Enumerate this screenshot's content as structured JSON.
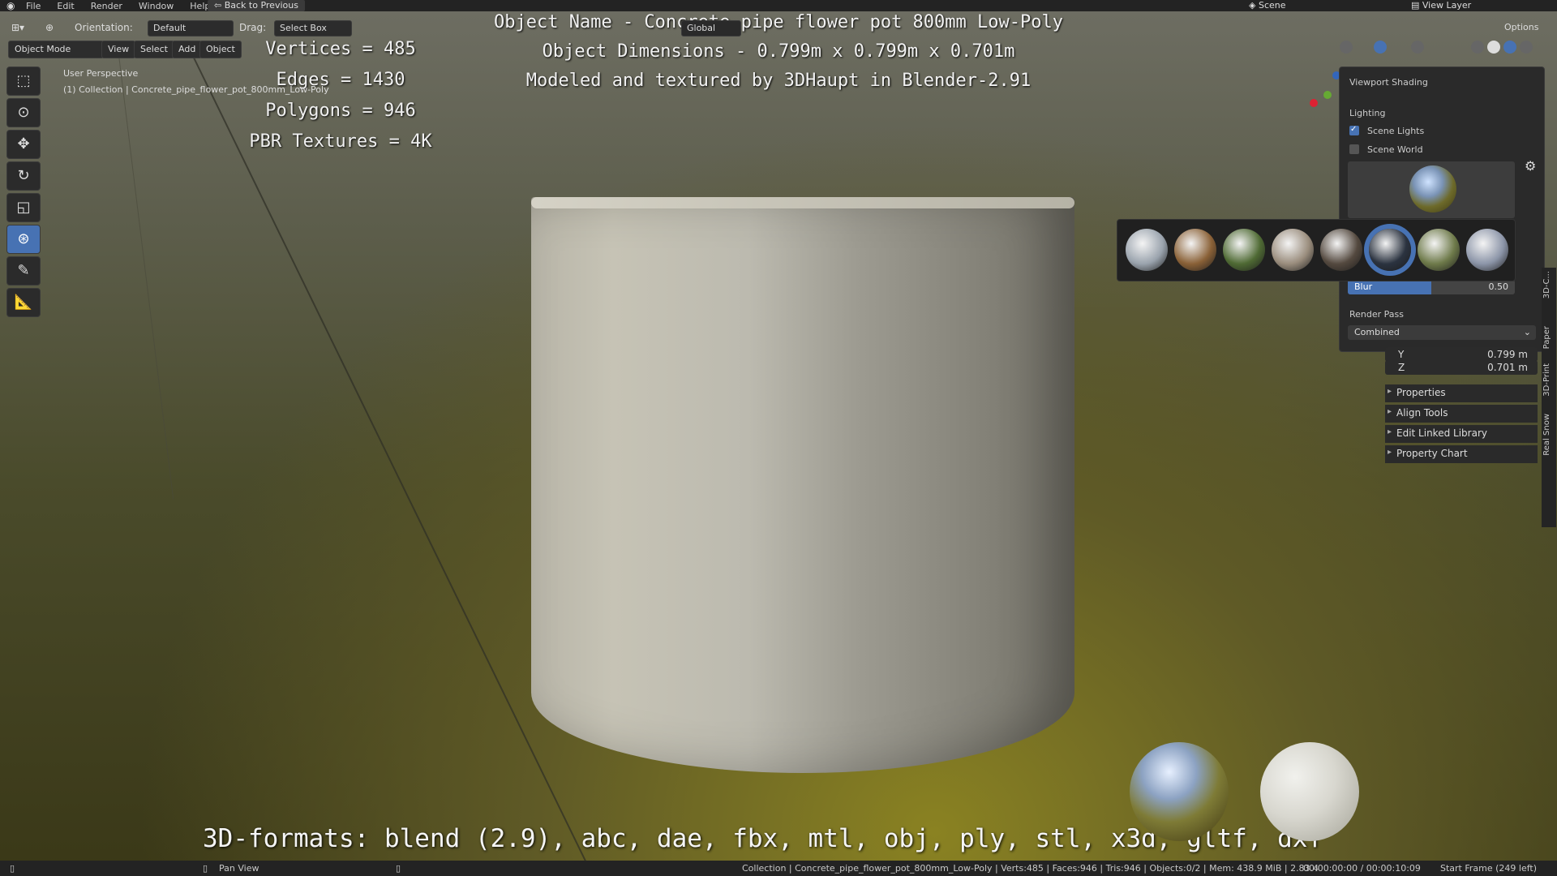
{
  "menu": [
    "File",
    "Edit",
    "Render",
    "Window",
    "Help"
  ],
  "back_btn": "Back to Previous",
  "scene": "Scene",
  "view_layer": "View Layer",
  "header": {
    "orientation_label": "Orientation:",
    "orientation_value": "Default",
    "drag_label": "Drag:",
    "drag_value": "Select Box",
    "transform_value": "Global",
    "options": "Options"
  },
  "header2": {
    "mode": "Object Mode",
    "view": "View",
    "select": "Select",
    "add": "Add",
    "object": "Object"
  },
  "overlay": {
    "perspective": "User Perspective",
    "collection": "(1) Collection | Concrete_pipe_flower_pot_800mm_Low-Poly"
  },
  "stats": {
    "vertices": "Vertices = 485",
    "edges": "Edges = 1430",
    "polygons": "Polygons = 946",
    "textures": "PBR Textures = 4K"
  },
  "title": {
    "name": "Object Name - Concrete pipe flower pot 800mm Low-Poly",
    "dims": "Object Dimensions -  0.799m x 0.799m x 0.701m",
    "credit": "Modeled and textured by 3DHaupt in Blender-2.91"
  },
  "formats": "3D-formats: blend (2.9), abc, dae, fbx, mtl, obj, ply, stl, x3d, gltf, dxf",
  "shading": {
    "title": "Viewport Shading",
    "lighting": "Lighting",
    "scene_lights": "Scene Lights",
    "scene_world": "Scene World",
    "blur_label": "Blur",
    "blur_value": "0.50",
    "blur_fraction": 0.5,
    "render_pass_label": "Render Pass",
    "render_pass_value": "Combined"
  },
  "hdri_thumbs": [
    {
      "name": "hdri-1",
      "color": "#9aa3ad"
    },
    {
      "name": "hdri-2",
      "color": "#8a6137"
    },
    {
      "name": "hdri-3",
      "color": "#4f6a34"
    },
    {
      "name": "hdri-4",
      "color": "#9a8d7d"
    },
    {
      "name": "hdri-5",
      "color": "#54493f"
    },
    {
      "name": "hdri-6",
      "color": "#2b3340"
    },
    {
      "name": "hdri-7",
      "color": "#6e7a4a"
    },
    {
      "name": "hdri-8",
      "color": "#8c95a8"
    }
  ],
  "npanel": {
    "y_label": "Y",
    "y_value": "0.799 m",
    "z_label": "Z",
    "z_value": "0.701 m",
    "items": [
      "Properties",
      "Align Tools",
      "Edit Linked Library",
      "Property Chart"
    ]
  },
  "vtabs": [
    "3D-C...",
    "Paper",
    "3D-Print",
    "Real Snow"
  ],
  "status": {
    "pan": "Pan View",
    "info": "Collection | Concrete_pipe_flower_pot_800mm_Low-Poly | Verts:485 | Faces:946 | Tris:946 | Objects:0/2 | Mem: 438.9 MiB | 2.83.4",
    "time": "00:00:00:00 / 00:00:10:09",
    "frame": "Start Frame (249 left)"
  },
  "colors": {
    "accent": "#4772b3"
  }
}
